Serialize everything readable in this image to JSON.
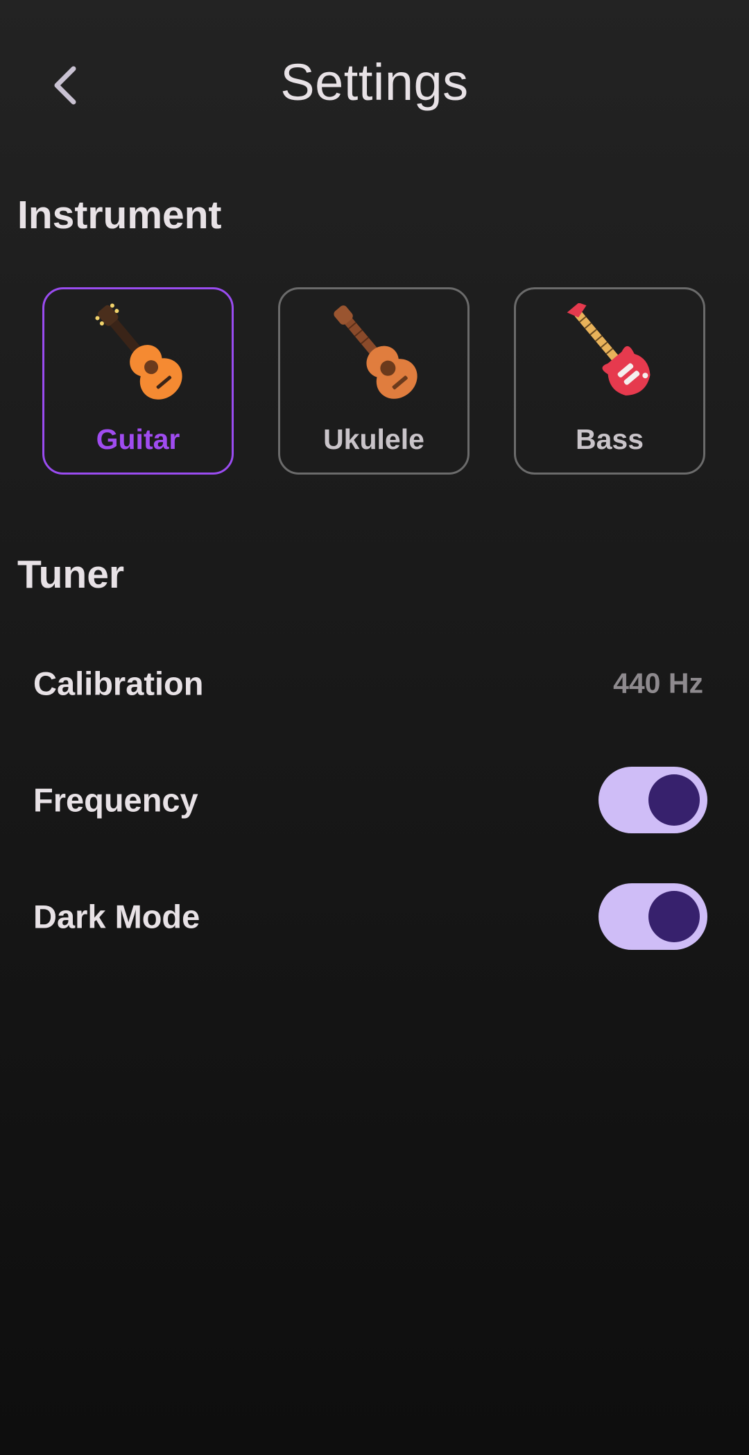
{
  "header": {
    "title": "Settings",
    "back_icon": "chevron-left-icon"
  },
  "sections": {
    "instrument_title": "Instrument",
    "tuner_title": "Tuner"
  },
  "instruments": [
    {
      "label": "Guitar",
      "icon": "acoustic-guitar-icon",
      "selected": true
    },
    {
      "label": "Ukulele",
      "icon": "ukulele-icon",
      "selected": false
    },
    {
      "label": "Bass",
      "icon": "bass-guitar-icon",
      "selected": false
    }
  ],
  "tuner": {
    "calibration_label": "Calibration",
    "calibration_value": "440 Hz",
    "frequency_label": "Frequency",
    "frequency_enabled": true,
    "dark_mode_label": "Dark Mode",
    "dark_mode_enabled": true
  },
  "colors": {
    "accent": "#9a4cf0",
    "toggle_track": "#cfbdf7",
    "toggle_knob": "#37216d",
    "card_border": "#6b6b6b"
  }
}
